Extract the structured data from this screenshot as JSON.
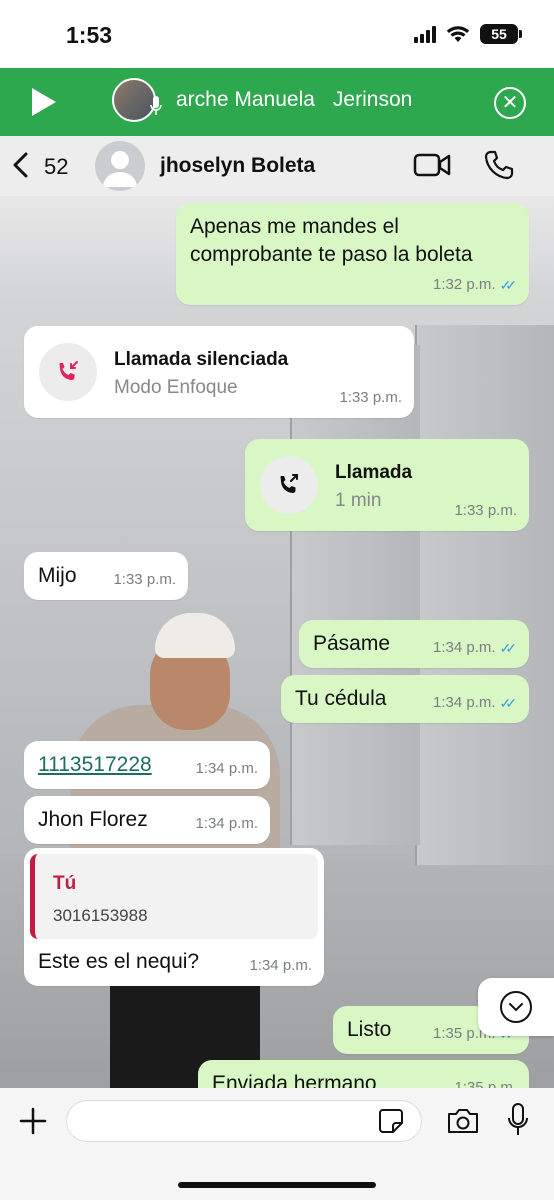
{
  "status_bar": {
    "time": "1:53",
    "battery": "55"
  },
  "audio_bar": {
    "names": [
      "arche Manuela",
      "Jerinson"
    ]
  },
  "header": {
    "back_count": "52",
    "contact_name": "jhoselyn Boleta"
  },
  "messages": [
    {
      "dir": "out",
      "text": "Apenas me mandes el comprobante te paso la boleta",
      "time": "1:32 p.m."
    },
    {
      "dir": "in",
      "type": "call",
      "title": "Llamada silenciada",
      "sub": "Modo Enfoque",
      "time": "1:33 p.m."
    },
    {
      "dir": "out",
      "type": "call",
      "title": "Llamada",
      "sub": "1 min",
      "time": "1:33 p.m."
    },
    {
      "dir": "in",
      "text": "Mijo",
      "time": "1:33 p.m."
    },
    {
      "dir": "out",
      "text": "Pásame",
      "time": "1:34 p.m."
    },
    {
      "dir": "out",
      "text": "Tu cédula",
      "time": "1:34 p.m."
    },
    {
      "dir": "in",
      "text": "1113517228",
      "time": "1:34 p.m."
    },
    {
      "dir": "in",
      "text": "Jhon Florez",
      "time": "1:34 p.m."
    },
    {
      "dir": "in",
      "quote_author": "Tú",
      "quote_text": "3016153988",
      "text": "Este es el nequi?",
      "time": "1:34 p.m."
    },
    {
      "dir": "out",
      "text": "Listo",
      "time": "1:35 p.m."
    },
    {
      "dir": "out",
      "text": "Enviada hermano",
      "time": "1:35 p.m."
    }
  ],
  "input": {
    "placeholder": ""
  },
  "colors": {
    "accent_green": "#2ea84f",
    "outgoing_bubble": "#d8f7c5",
    "incoming_bubble": "#ffffff",
    "read_ticks": "#34a0e0",
    "missed_call_red": "#e0245e",
    "quote_red": "#c01d45",
    "link_green": "#1d6f5c"
  },
  "icons": [
    "play-icon",
    "mic-icon",
    "close-icon",
    "chevron-left-icon",
    "person-icon",
    "video-call-icon",
    "phone-icon",
    "missed-call-icon",
    "outgoing-call-icon",
    "chevron-down-icon",
    "plus-icon",
    "sticker-icon",
    "camera-icon",
    "microphone-icon"
  ]
}
